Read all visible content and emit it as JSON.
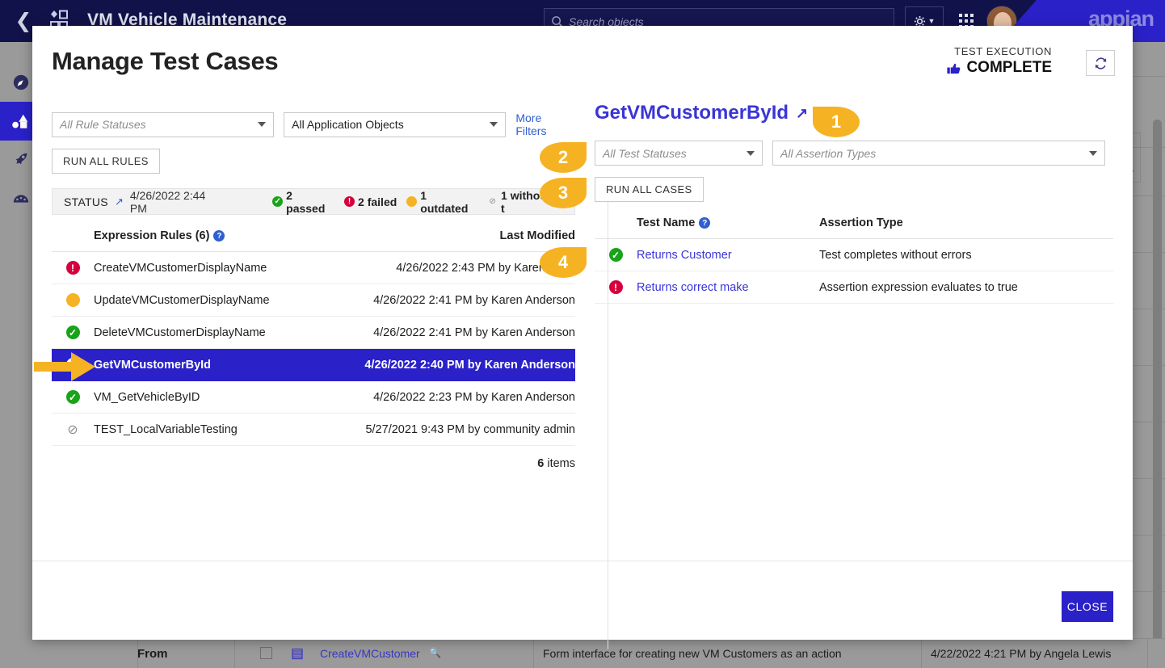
{
  "background": {
    "app_title": "VM Vehicle Maintenance",
    "search_placeholder": "Search objects",
    "brand": "appian",
    "back_icon": "chevron-left-icon",
    "logo_icon": "app-shapes-icon",
    "search_icon": "search-globe-icon",
    "gear_icon": "gear-icon",
    "grid_icon": "grid-apps-icon",
    "avatar_icon": "user-avatar",
    "sidebar_icons": [
      "compass-icon",
      "shapes-icon",
      "rocket-icon",
      "gauge-icon"
    ],
    "bottom_row": {
      "expand_icon": "chevron-right-icon",
      "from_label": "From",
      "doc_icon": "interface-icon",
      "object_name": "CreateVMCustomer",
      "object_link_icon": "preview-icon",
      "description": "Form interface for creating new VM Customers as an action",
      "modified": "4/22/2022 4:21 PM by Angela Lewis"
    },
    "down_arrow_icon": "down-arrow-icon"
  },
  "modal": {
    "title": "Manage Test Cases",
    "execution": {
      "label": "TEST EXECUTION",
      "status": "COMPLETE",
      "status_icon": "thumbs-up-icon"
    },
    "refresh_icon": "refresh-icon",
    "close_label": "CLOSE",
    "left": {
      "filters": {
        "rule_status_value": "All Rule Statuses",
        "app_object_value": "All Application Objects",
        "more_filters_label": "More Filters"
      },
      "run_all_rules_label": "RUN ALL RULES",
      "status_bar": {
        "label": "STATUS",
        "link_icon": "external-link-icon",
        "timestamp": "4/26/2022 2:44 PM",
        "chips": [
          {
            "icon": "pass-icon",
            "text": "2 passed",
            "color": "#19a319"
          },
          {
            "icon": "fail-icon",
            "text": "2 failed",
            "color": "#d6003c"
          },
          {
            "icon": "outdated-icon",
            "text": "1 outdated",
            "color": "#f5b324"
          },
          {
            "icon": "none-icon",
            "text": "1 without t",
            "color": "#8a8a8a"
          }
        ]
      },
      "table": {
        "col_name": "Expression Rules (6)",
        "col_name_help_icon": "help-icon",
        "col_modified": "Last Modified",
        "rows": [
          {
            "status": "fail",
            "name": "CreateVMCustomerDisplayName",
            "modified": "4/26/2022 2:43 PM by Karen Ande",
            "selected": false
          },
          {
            "status": "out",
            "name": "UpdateVMCustomerDisplayName",
            "modified": "4/26/2022 2:41 PM by Karen Anderson",
            "selected": false
          },
          {
            "status": "pass",
            "name": "DeleteVMCustomerDisplayName",
            "modified": "4/26/2022 2:41 PM by Karen Anderson",
            "selected": false
          },
          {
            "status": "info",
            "name": "GetVMCustomerById",
            "modified": "4/26/2022 2:40 PM by Karen Anderson",
            "selected": true
          },
          {
            "status": "pass",
            "name": "VM_GetVehicleByID",
            "modified": "4/26/2022 2:23 PM by Karen Anderson",
            "selected": false
          },
          {
            "status": "none",
            "name": "TEST_LocalVariableTesting",
            "modified": "5/27/2021 9:43 PM by community admin",
            "selected": false
          }
        ],
        "items_count": "6",
        "items_label": "items"
      }
    },
    "right": {
      "object_title": "GetVMCustomerById",
      "object_link_icon": "external-link-icon",
      "filters": {
        "test_status_value": "All Test Statuses",
        "assertion_type_value": "All Assertion Types"
      },
      "run_all_cases_label": "RUN ALL CASES",
      "table": {
        "col_test_name": "Test Name",
        "col_test_name_help_icon": "help-icon",
        "col_assertion": "Assertion Type",
        "rows": [
          {
            "status": "pass",
            "name": "Returns Customer",
            "assertion": "Test completes without errors"
          },
          {
            "status": "fail",
            "name": "Returns correct make",
            "assertion": "Assertion expression evaluates to true"
          }
        ]
      }
    }
  },
  "callouts": [
    {
      "label": "1",
      "dir": "l"
    },
    {
      "label": "2",
      "dir": "r"
    },
    {
      "label": "3",
      "dir": "r"
    },
    {
      "label": "4",
      "dir": "r"
    }
  ],
  "colors": {
    "accent": "#2a21c9",
    "callout": "#f5b324",
    "pass": "#19a319",
    "fail": "#d6003c",
    "outdated": "#f5b324",
    "link": "#3a35d6"
  }
}
